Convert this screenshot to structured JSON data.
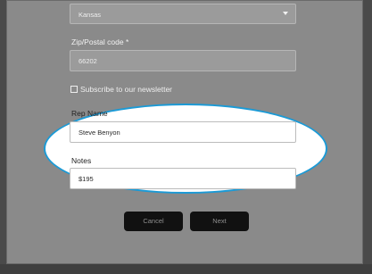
{
  "form": {
    "state": {
      "selected": "Kansas"
    },
    "zip": {
      "label": "Zip/Postal code *",
      "value": "66202"
    },
    "newsletter": {
      "label": "Subscribe to our newsletter",
      "checked": false
    },
    "rep_name": {
      "label": "Rep Name",
      "value": "Steve Benyon"
    },
    "notes": {
      "label": "Notes",
      "value": "$195"
    }
  },
  "buttons": {
    "cancel": "Cancel",
    "next": "Next"
  },
  "colors": {
    "highlight_border": "#1b9ad6",
    "button_bg": "#111111",
    "overlay": "#8a8a8a"
  }
}
